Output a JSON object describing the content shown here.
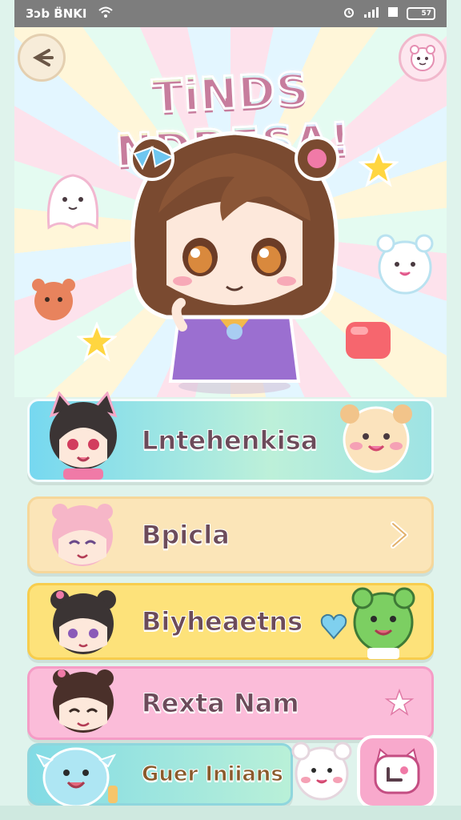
{
  "status_bar": {
    "left_text": "3ɔb B̈NKI",
    "battery_text": "57"
  },
  "header": {
    "title": "TiNDS NDDESA!",
    "back_icon": "back-arrow-icon",
    "profile_icon": "kawaii-avatar-icon"
  },
  "menu": {
    "items": [
      {
        "label": "Lntehenkisa",
        "icon": "none"
      },
      {
        "label": "Bpicla",
        "icon": "chevron-right-icon"
      },
      {
        "label": "Biyheaetns",
        "icon": "none"
      },
      {
        "label": "Rexta Nam",
        "icon": "star-icon"
      },
      {
        "label": "Guer Iniians",
        "icon": "none"
      }
    ]
  },
  "colors": {
    "card1": "#76d8f0",
    "card2": "#fbe5b8",
    "card3": "#fde27a",
    "card4": "#fbbcd9",
    "card5": "#82dbe5",
    "fab": "#f8a9cc"
  }
}
